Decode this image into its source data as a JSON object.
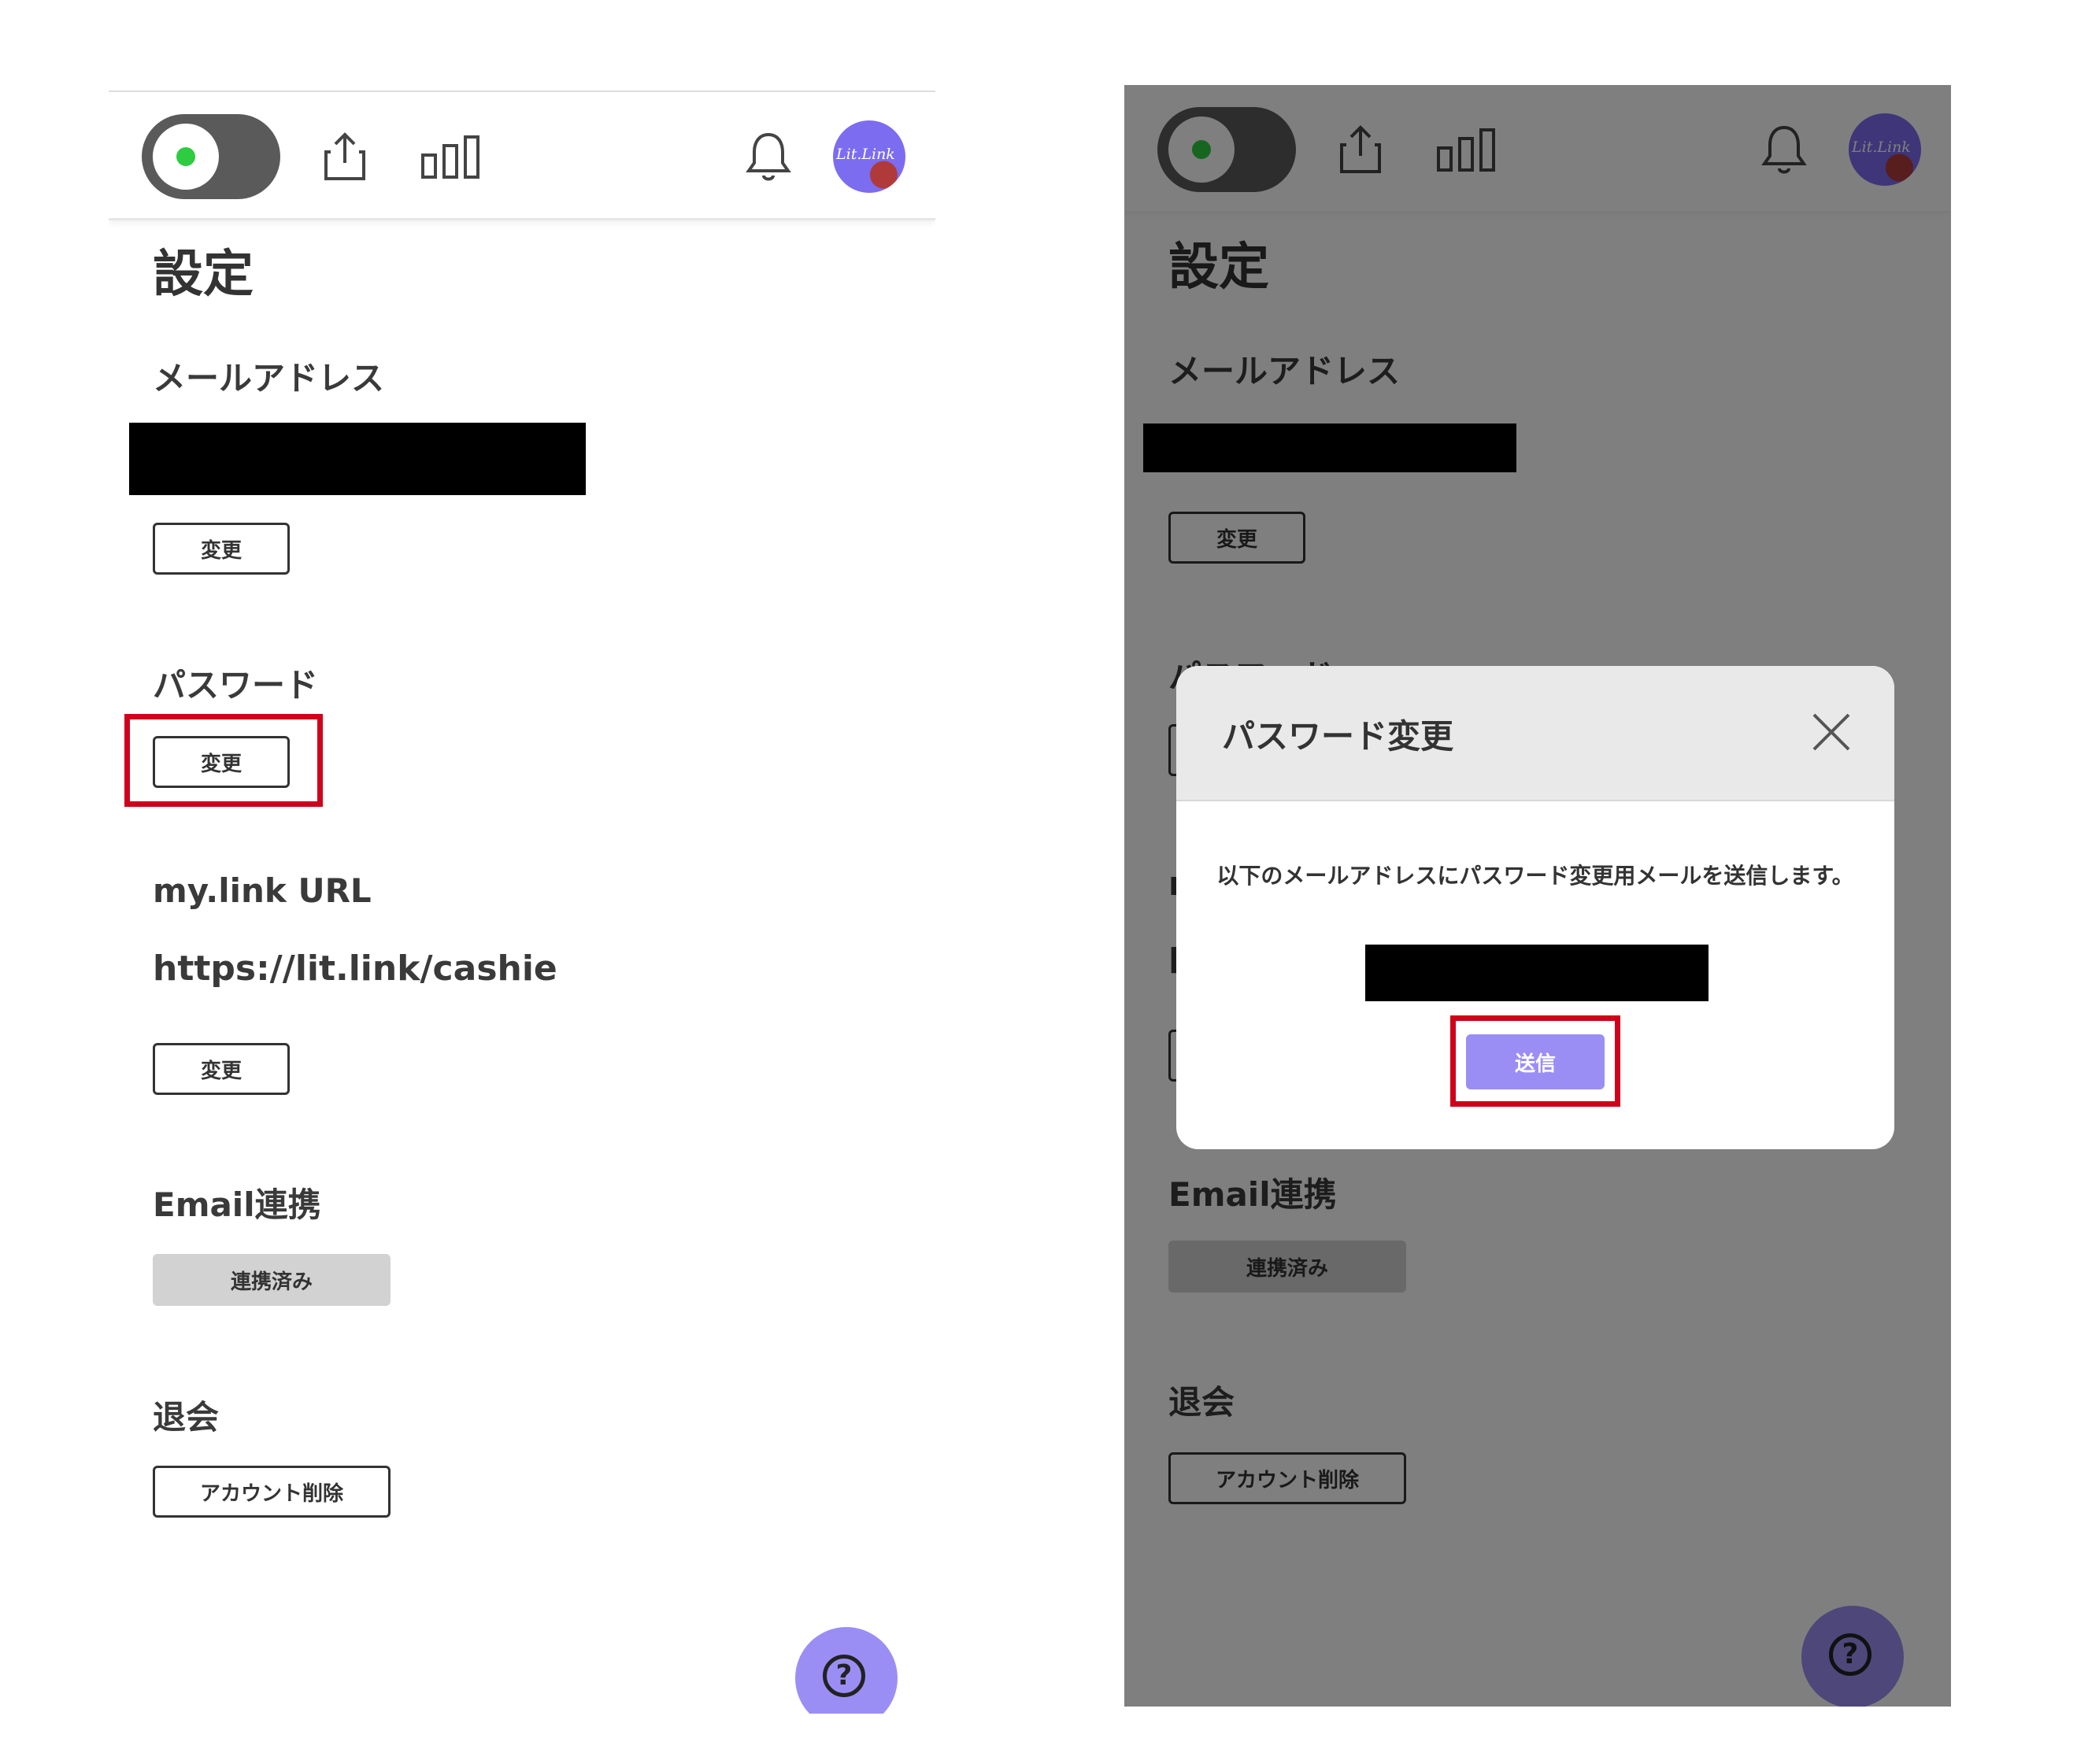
{
  "page": {
    "title": "設定",
    "sections": {
      "email": {
        "title": "メールアドレス",
        "button": "変更"
      },
      "password": {
        "title": "パスワード",
        "button": "変更"
      },
      "mylink": {
        "title": "my.link URL",
        "url": "https://lit.link/cashie",
        "button": "変更"
      },
      "email_link": {
        "title": "Email連携",
        "button": "連携済み"
      },
      "withdraw": {
        "title": "退会",
        "button": "アカウント削除"
      }
    }
  },
  "header": {
    "avatar_text": "Lit.Link",
    "icons": [
      "toggle-switch",
      "share-icon",
      "stats-icon",
      "bell-icon",
      "avatar"
    ]
  },
  "help": {
    "label": "?"
  },
  "modal": {
    "title": "パスワード変更",
    "message": "以下のメールアドレスにパスワード変更用メールを送信します。",
    "send_button": "送信"
  },
  "colors": {
    "accent": "#9a8ef5",
    "highlight": "#d0021b",
    "toggle_on": "#2ecc40",
    "overlay": "rgba(0,0,0,0.5)"
  }
}
